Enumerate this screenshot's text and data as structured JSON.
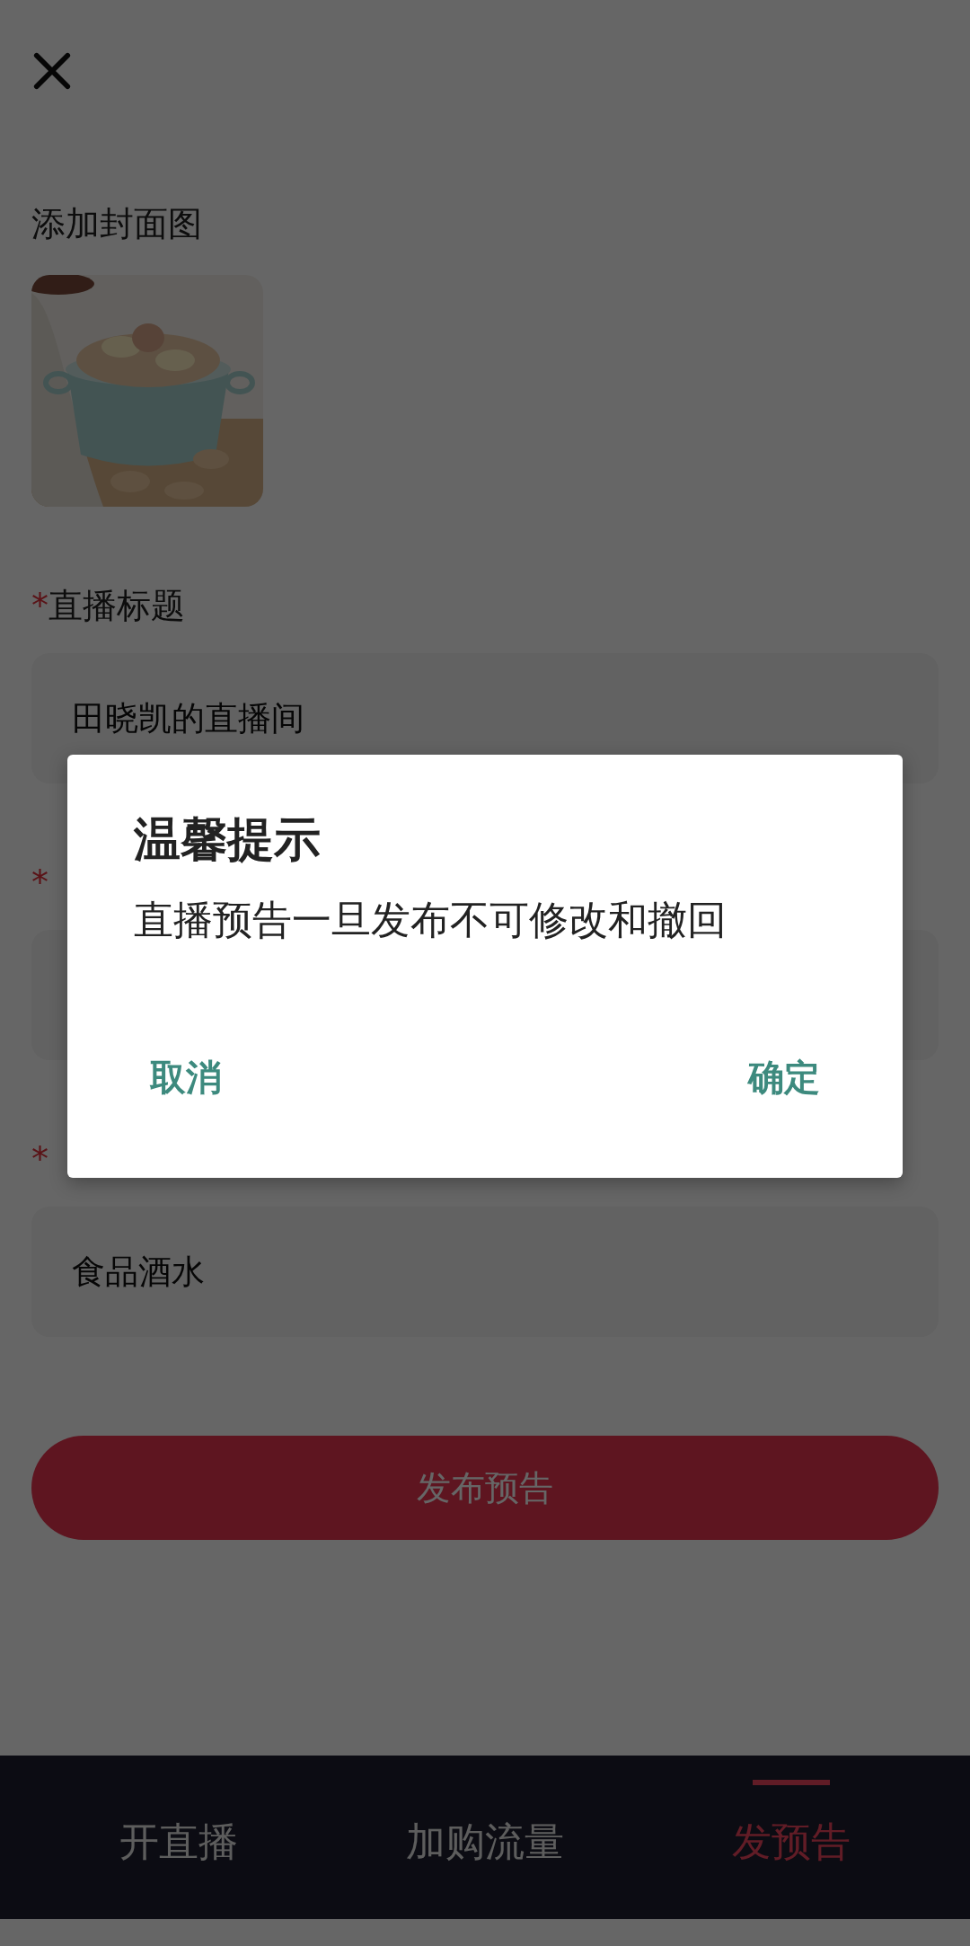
{
  "cover": {
    "label": "添加封面图"
  },
  "fields": [
    {
      "marker": "*",
      "label": "直播标题",
      "value": "田晓凯的直播间"
    },
    {
      "marker": "*"
    },
    {
      "marker": "*",
      "value": "食品酒水"
    }
  ],
  "publish_button": "发布预告",
  "tabs": [
    {
      "label": "开直播",
      "selected": false
    },
    {
      "label": "加购流量",
      "selected": false
    },
    {
      "label": "发预告",
      "selected": true
    }
  ],
  "dialog": {
    "title": "温馨提示",
    "message": "直播预告一旦发布不可修改和撤回",
    "buttons": [
      "取消",
      "确定"
    ]
  }
}
